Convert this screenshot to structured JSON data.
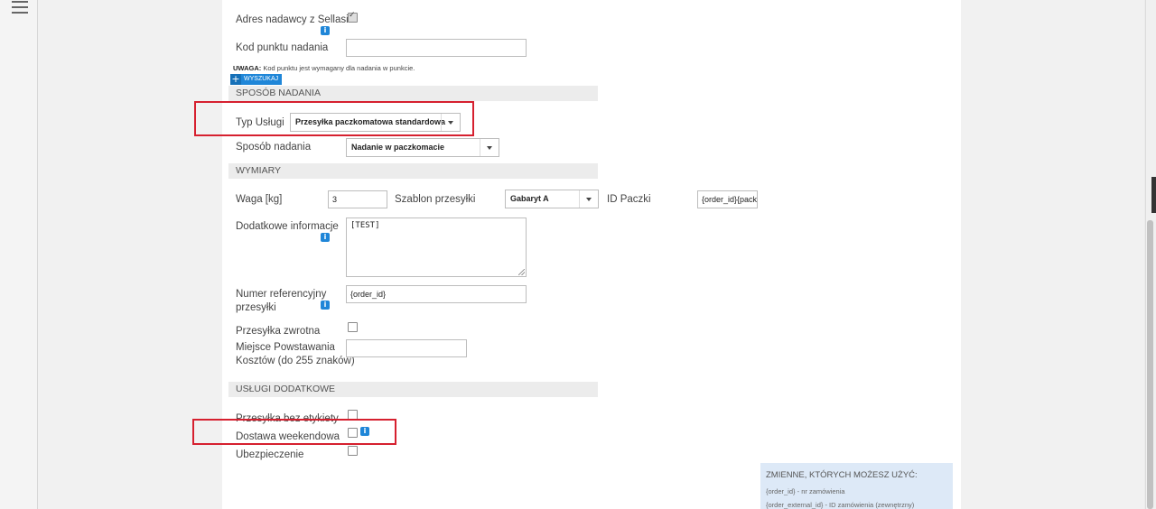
{
  "sender_address": {
    "label": "Adres nadawcy z Sellasist",
    "checked": true
  },
  "pickup_point": {
    "label": "Kod punktu nadania",
    "value": "",
    "note_bold": "UWAGA:",
    "note_text": "Kod punktu jest wymagany dla nadania w punkcie.",
    "search_label": "WYSZUKAJ"
  },
  "section_shipping_method": {
    "title": "SPOSÓB NADANIA"
  },
  "service_type": {
    "label": "Typ Usługi",
    "value": "Przesyłka paczkomatowa standardowa"
  },
  "shipping_method": {
    "label": "Sposób nadania",
    "value": "Nadanie w paczkomacie"
  },
  "section_dimensions": {
    "title": "WYMIARY"
  },
  "weight": {
    "label": "Waga [kg]",
    "value": "3"
  },
  "template": {
    "label": "Szablon przesyłki",
    "value": "Gabaryt A"
  },
  "package_id": {
    "label": "ID Paczki",
    "value": "{order_id}{pack"
  },
  "additional_info": {
    "label": "Dodatkowe informacje",
    "value": "[TEST]"
  },
  "reference_number": {
    "label_line1": "Numer referencyjny",
    "label_line2": "przesyłki",
    "value": "{order_id}"
  },
  "return_shipment": {
    "label": "Przesyłka zwrotna",
    "checked": false
  },
  "cost_center": {
    "label_line1": "Miejsce Powstawania",
    "label_line2": "Kosztów (do 255 znaków)",
    "value": ""
  },
  "section_additional_services": {
    "title": "USŁUGI DODATKOWE"
  },
  "no_label": {
    "label": "Przesyłka bez etykiety",
    "checked": false
  },
  "weekend_delivery": {
    "label": "Dostawa weekendowa",
    "checked": false
  },
  "insurance": {
    "label": "Ubezpieczenie",
    "checked": false
  },
  "variables_panel": {
    "title": "ZMIENNE, KTÓRYCH MOŻESZ UŻYĆ:",
    "lines": [
      "{order_id} - nr zamówienia",
      "{order_external_id} - ID zamówienia (zewnętrzny)"
    ]
  },
  "info_icon_glyph": "i",
  "highlight_color": "#d6202f",
  "accent_color": "#1f86d8"
}
